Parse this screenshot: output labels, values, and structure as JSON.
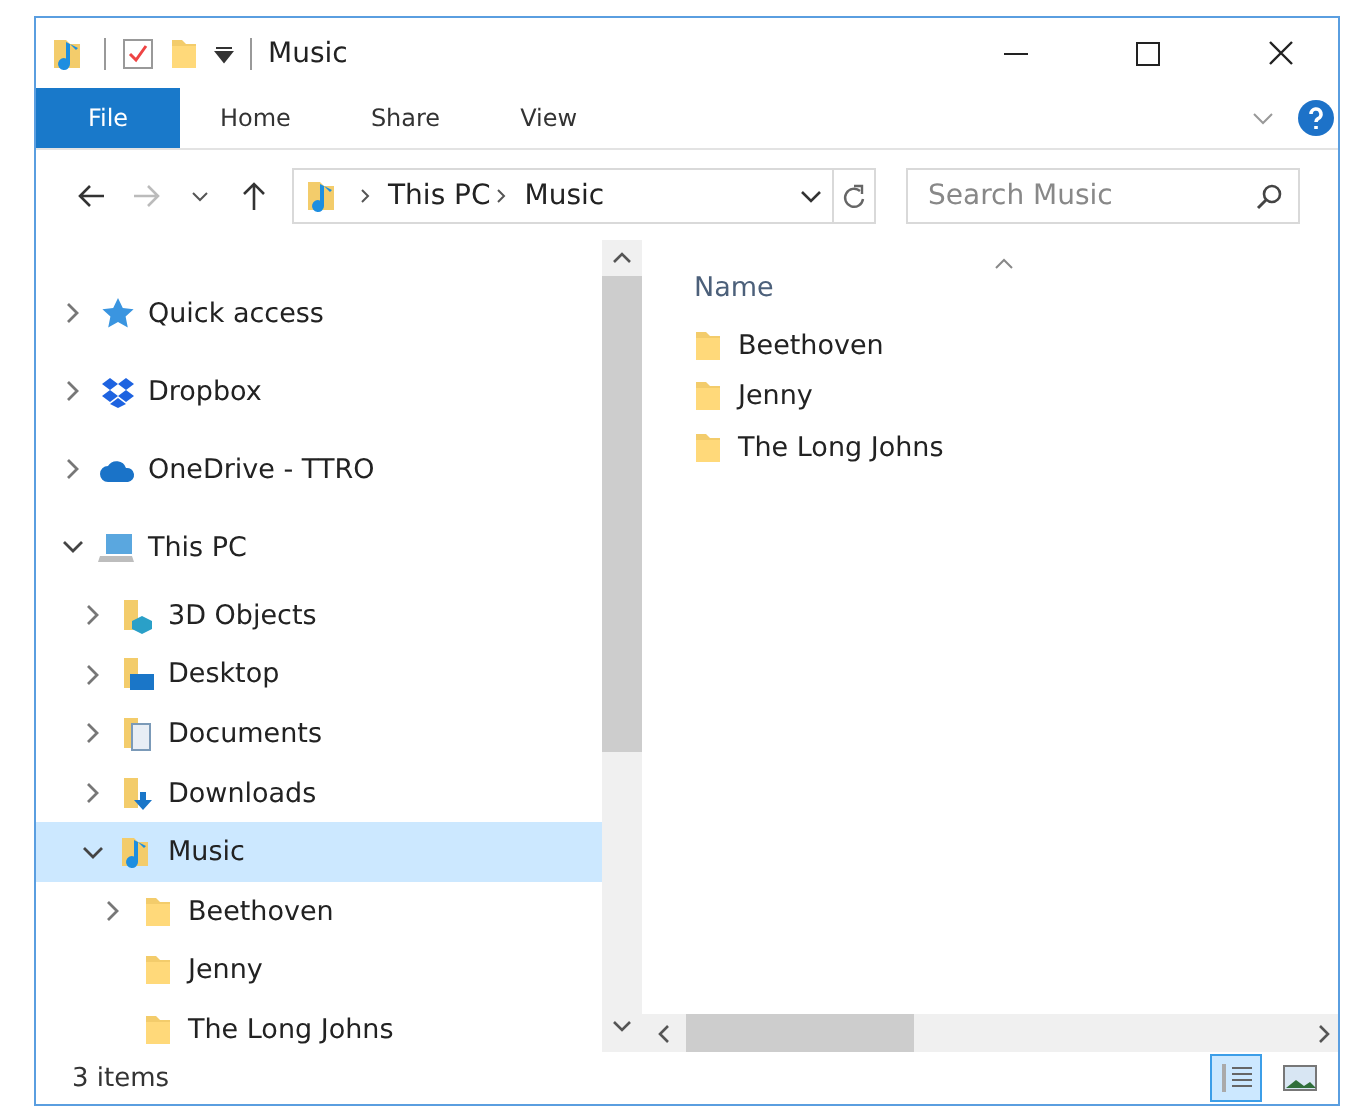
{
  "window": {
    "title": "Music"
  },
  "ribbon_tabs": [
    {
      "label": "File",
      "kind": "file",
      "selected": false
    },
    {
      "label": "Home",
      "kind": "tab",
      "selected": false
    },
    {
      "label": "Share",
      "kind": "tab",
      "selected": false
    },
    {
      "label": "View",
      "kind": "tab",
      "selected": false
    }
  ],
  "address": {
    "path": [
      "This PC",
      "Music"
    ]
  },
  "search": {
    "placeholder": "Search Music"
  },
  "nav": [
    {
      "label": "Quick access",
      "kind": "star",
      "expandable": true,
      "expanded": false,
      "selected": false
    },
    {
      "label": "Dropbox",
      "kind": "dropbox",
      "expandable": true,
      "expanded": false,
      "selected": false
    },
    {
      "label": "OneDrive - TTRO",
      "kind": "cloud",
      "expandable": true,
      "expanded": false,
      "selected": false
    },
    {
      "label": "This PC",
      "kind": "pc",
      "expandable": true,
      "expanded": true,
      "selected": false,
      "children": [
        {
          "label": "3D Objects",
          "kind": "objects",
          "expandable": true,
          "expanded": false,
          "selected": false
        },
        {
          "label": "Desktop",
          "kind": "desktop",
          "expandable": true,
          "expanded": false,
          "selected": false
        },
        {
          "label": "Documents",
          "kind": "documents",
          "expandable": true,
          "expanded": false,
          "selected": false
        },
        {
          "label": "Downloads",
          "kind": "downloads",
          "expandable": true,
          "expanded": false,
          "selected": false
        },
        {
          "label": "Music",
          "kind": "music",
          "expandable": true,
          "expanded": true,
          "selected": true,
          "children": [
            {
              "label": "Beethoven",
              "kind": "folder",
              "expandable": true,
              "expanded": false,
              "selected": false
            },
            {
              "label": "Jenny",
              "kind": "folder",
              "expandable": false,
              "selected": false
            },
            {
              "label": "The Long Johns",
              "kind": "folder",
              "expandable": false,
              "selected": false
            }
          ]
        }
      ]
    }
  ],
  "files": {
    "column": "Name",
    "items": [
      {
        "name": "Beethoven"
      },
      {
        "name": "Jenny"
      },
      {
        "name": "The Long Johns"
      }
    ]
  },
  "status_bar": {
    "count": "3 items",
    "views": [
      {
        "kind": "details",
        "selected": true
      },
      {
        "kind": "tiles",
        "selected": false
      }
    ]
  }
}
